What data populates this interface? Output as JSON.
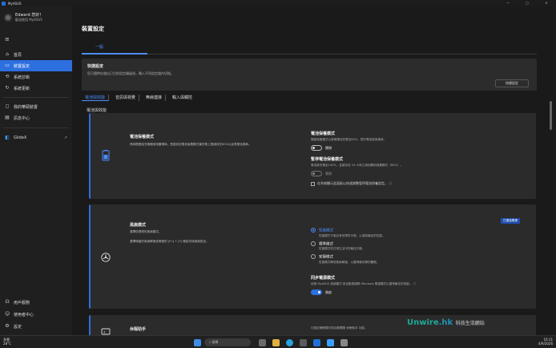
{
  "app": {
    "title": "MyASUS",
    "win_min": "—",
    "win_max": "▢",
    "win_close": "✕"
  },
  "user": {
    "name": "Edward 您好！",
    "sub": "歡迎使用 MyASUS"
  },
  "sidebar": {
    "items": [
      {
        "label": "首頁",
        "icon": "home-icon"
      },
      {
        "label": "裝置設定",
        "icon": "settings-icon"
      },
      {
        "label": "系統診斷",
        "icon": "diagnose-icon"
      },
      {
        "label": "系統更新",
        "icon": "update-icon"
      },
      {
        "label": "我的華碩裝置",
        "icon": "device-icon"
      },
      {
        "label": "訊息中心",
        "icon": "message-icon"
      },
      {
        "label": "GlideX",
        "icon": "glidex-icon"
      },
      {
        "label": "用戶服務",
        "icon": "headset-icon"
      },
      {
        "label": "使用者中心",
        "icon": "user-icon"
      },
      {
        "label": "設定",
        "icon": "gear-icon"
      }
    ]
  },
  "page": {
    "title": "裝置設定",
    "top_tab": "一般"
  },
  "quick": {
    "title": "快捷設定",
    "desc": "您可隨時存儲自己目前設定擴展項，轉入不同設定檔內切換。",
    "button": "快捷設定"
  },
  "subtabs": [
    "電池與效能",
    "音訊與視覺",
    "無線連接",
    "輸入與觸控"
  ],
  "section_title": "電池與效能",
  "battery": {
    "title": "電池保養模式",
    "desc": "長時間連接充電器使用筆電時，透過設定電池保養模式讓充電上限維持在80%以延長電池壽命。",
    "opt1_h": "電池保養模式",
    "opt1_s": "開啟保護模式以將鋰電池充電至80%，提升電池使用壽命。",
    "opt1_toggle": "關閉",
    "opt2_h": "暫停電池保養模式",
    "opt2_s": "電池將充電至100%，並維持在 24 小時之後回歸到保養模式（80%）。",
    "opt2_toggle": "關閉",
    "chk": "在系統顯示此面板以快速調整暫停電池保養設定。"
  },
  "fan": {
    "title": "風扇模式",
    "desc1": "選擇您理想的風扇模式。",
    "desc2": "選擇適當的風扇轉速依照個別 [Fn] + [F] 輕鬆切換風扇設定。",
    "badge": "已連接電源",
    "r1": "性能模式",
    "r1s": "性能模式平衡且有效率的平衡，以達到最佳的性能。",
    "r2": "標準模式",
    "r2s": "性能模式的日常生活中的最佳平衡。",
    "r3": "安靜模式",
    "r3s": "性能模式降低風扇轉速，以獲得最安靜的體驗。",
    "sync_h": "同步電源模式",
    "sync_s": "依據 MyASUS 風扇模式 設定動態調節 Windows 電源模式以獲得最佳的效能。",
    "sync_toggle": "開啟"
  },
  "sleep": {
    "title": "休眠助手",
    "s": "切換至睡眠模式時自動關閉 休眠助手 功能。"
  },
  "taskbar": {
    "temp": "28°C",
    "weather": "多雲",
    "search": "搜尋",
    "time": "10:11",
    "date": "4/9/2026"
  },
  "watermark": {
    "a": "Unwire",
    "b": ".hk",
    "c": "科技生活網站"
  }
}
